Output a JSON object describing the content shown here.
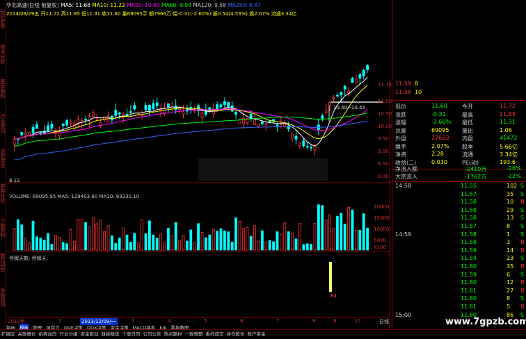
{
  "left_tabs": [
    "分时走势",
    "技术分析",
    "基本资料",
    "行业资讯",
    "历史成交",
    "财务分析",
    "个股资料",
    "股东研究",
    "多股同列"
  ],
  "header": {
    "title": "华北高速(日线 前复权)",
    "ma_items": [
      {
        "label": "MA5: 11.68",
        "color": "#ffffff"
      },
      {
        "label": "MA10: 11.22",
        "color": "#ffff00"
      },
      {
        "label": "MA20: 10.83",
        "color": "#ff00ff"
      },
      {
        "label": "MA60: 9.94",
        "color": "#00ff00"
      },
      {
        "label": "MA120: 9.58",
        "color": "#c0c0c0"
      },
      {
        "label": "MA250: 8.87",
        "color": "#3366ff"
      }
    ],
    "info": "2014/08/29五 开11.72 高11.85 低11.31 收11.60 量69095手 额7966万 幅-0.31(-2.60%) 振0.54(4.53%) 换2.07% 流通3.34亿 四区开发"
  },
  "price_chart": {
    "annotation_high": "10.40~10.45",
    "annotation_low": "8.12",
    "y_ticks": [
      "11.75",
      "11.00",
      "10.50",
      "10.00",
      "9.50",
      "9.00",
      "8.50",
      "8.00"
    ]
  },
  "volume_chart": {
    "header": "VOLUME: 69095.95 MA5: 129403.60 MA10: 93230.10",
    "y_ticks": [
      "20000",
      "15000",
      "10000",
      "5000",
      "X100"
    ]
  },
  "indicator_chart": {
    "header": "停牌天数: 停牌天:",
    "value_label": "84"
  },
  "time_axis": {
    "labels": [
      "2013年",
      "2",
      "3",
      "4",
      "5",
      "6",
      "7",
      "8",
      "9",
      "10"
    ],
    "highlight": "2013/12/09/一",
    "right_label": "日线"
  },
  "indicator_tabs": [
    "指标",
    "模板",
    "管理",
    "风存力",
    "DDE决策",
    "DDX决策",
    "资金决策",
    "MACD基本",
    "Kdj",
    "看指数图"
  ],
  "right_panel": {
    "order_book_top": [
      {
        "price": "11.59",
        "vol": "8"
      },
      {
        "price": "11.58",
        "vol": "10"
      }
    ],
    "quote": [
      {
        "l1": "现价",
        "v1": "11.60",
        "l2": "今开",
        "v2": "11.72",
        "c1": "#00ff00",
        "c2": "#ff3333"
      },
      {
        "l1": "涨跌",
        "v1": "-0.31",
        "l2": "最高",
        "v2": "11.85",
        "c1": "#00ff00",
        "c2": "#ff3333"
      },
      {
        "l1": "涨幅",
        "v1": "-2.60%",
        "l2": "最低",
        "v2": "11.31",
        "c1": "#00ff00",
        "c2": "#00ff00"
      },
      {
        "l1": "总量",
        "v1": "69095",
        "l2": "量比",
        "v2": "1.06",
        "c1": "#ffff00",
        "c2": "#ffff00"
      },
      {
        "l1": "外盘",
        "v1": "27623",
        "l2": "内盘",
        "v2": "41472",
        "c1": "#ff3333",
        "c2": "#00ff00"
      },
      {
        "l1": "换手",
        "v1": "2.07%",
        "l2": "股本",
        "v2": "5.66亿",
        "c1": "#ffff00",
        "c2": "#ffff00"
      },
      {
        "l1": "净资",
        "v1": "2.28",
        "l2": "流通",
        "v2": "3.34亿",
        "c1": "#ffff00",
        "c2": "#ffff00"
      },
      {
        "l1": "收益(二)",
        "v1": "0.030",
        "l2": "PE(动)",
        "v2": "193.6",
        "c1": "#ffff00",
        "c2": "#ffff00"
      }
    ],
    "flows": [
      {
        "label": "净流入额",
        "value": "-2410万",
        "pct": "-26%"
      },
      {
        "label": "大宗流入",
        "value": "-1762万",
        "pct": "-22%"
      }
    ],
    "ticks": [
      {
        "time": "14:58",
        "price": "11.55",
        "vol": "102",
        "dir": "S"
      },
      {
        "time": "",
        "price": "11.57",
        "vol": "35",
        "dir": "S"
      },
      {
        "time": "",
        "price": "11.58",
        "vol": "10",
        "dir": "B"
      },
      {
        "time": "",
        "price": "11.58",
        "vol": "29",
        "dir": "S"
      },
      {
        "time": "",
        "price": "11.58",
        "vol": "13",
        "dir": "S"
      },
      {
        "time": "",
        "price": "11.57",
        "vol": "8",
        "dir": "S"
      },
      {
        "time": "14:59",
        "price": "11.58",
        "vol": "1",
        "dir": "S"
      },
      {
        "time": "",
        "price": "11.58",
        "vol": "3",
        "dir": "B"
      },
      {
        "time": "",
        "price": "11.59",
        "vol": "14",
        "dir": "B"
      },
      {
        "time": "",
        "price": "11.59",
        "vol": "23",
        "dir": "S"
      },
      {
        "time": "",
        "price": "11.60",
        "vol": "35",
        "dir": "B"
      },
      {
        "time": "",
        "price": "11.59",
        "vol": "6",
        "dir": "S"
      },
      {
        "time": "",
        "price": "11.60",
        "vol": "12",
        "dir": "B"
      },
      {
        "time": "",
        "price": "11.61",
        "vol": "27",
        "dir": "B"
      },
      {
        "time": "",
        "price": "11.60",
        "vol": "8",
        "dir": "S"
      },
      {
        "time": "",
        "price": "11.61",
        "vol": "5",
        "dir": "B"
      },
      {
        "time": "15:00",
        "price": "11.60",
        "vol": "86",
        "dir": "S"
      }
    ]
  },
  "bottom_bar": [
    "扩展区",
    "关联报价",
    "机构动向",
    "行业分组",
    "资金驱动",
    "财经精选",
    "个股日历",
    "公司公告",
    "热点题材",
    "一致预期",
    "委托成交",
    "持仓股份",
    "账户资金"
  ],
  "watermark": "www.7gpzb.com"
}
